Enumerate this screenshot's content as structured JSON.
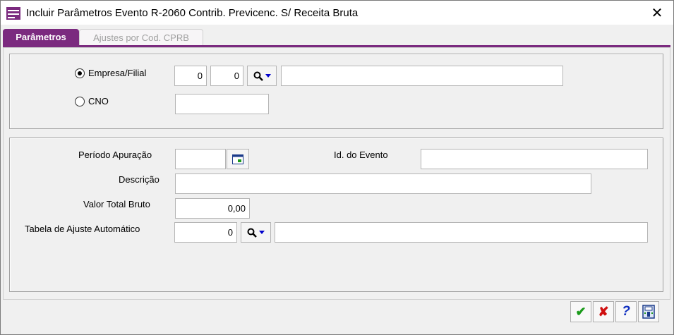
{
  "window": {
    "title": "Incluir Parâmetros Evento R-2060 Contrib. Previcenc. S/ Receita Bruta",
    "close_symbol": "✕"
  },
  "tabs": [
    {
      "label": "Parâmetros",
      "active": true
    },
    {
      "label": "Ajustes por Cod. CPRB",
      "active": false
    }
  ],
  "group1": {
    "radio_empresa": {
      "label": "Empresa/Filial",
      "checked": true
    },
    "radio_cno": {
      "label": "CNO",
      "checked": false
    },
    "empresa_value": "0",
    "filial_value": "0",
    "empresa_name": "",
    "cno_value": ""
  },
  "group2": {
    "periodo_label": "Período Apuração",
    "periodo_value": "",
    "id_evento_label": "Id. do Evento",
    "id_evento_value": "",
    "descricao_label": "Descrição",
    "descricao_value": "",
    "valor_label": "Valor Total Bruto",
    "valor_value": "0,00",
    "tabela_label": "Tabela de Ajuste Automático",
    "tabela_value": "0",
    "tabela_desc": ""
  },
  "toolbar": {
    "ok_symbol": "✔",
    "cancel_symbol": "✘",
    "help_symbol": "?"
  },
  "colors": {
    "accent": "#7b2a7f",
    "ok": "#1a9a1a",
    "cancel": "#d01010",
    "help": "#1030c0"
  },
  "icons": [
    "app-icon",
    "close-icon",
    "search-icon",
    "dropdown-arrow-icon",
    "calendar-icon",
    "confirm-icon",
    "cancel-icon",
    "help-icon",
    "save-exit-icon"
  ]
}
